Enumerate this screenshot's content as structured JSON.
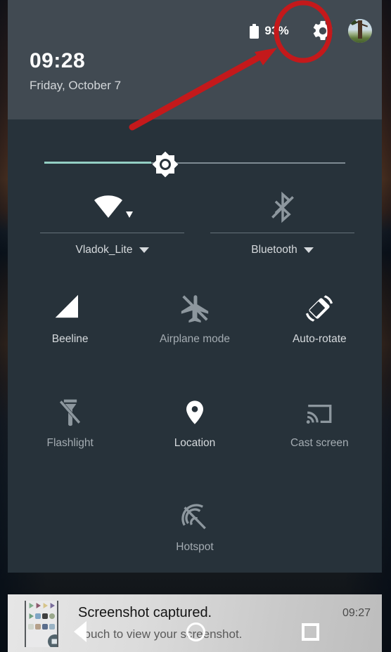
{
  "header": {
    "battery_icon": "battery-icon",
    "battery_percent": "93%",
    "settings_icon": "gear-icon",
    "avatar": "user-avatar",
    "time": "09:28",
    "date": "Friday, October 7"
  },
  "brightness": {
    "name": "brightness-slider",
    "icon": "brightness-sun-icon",
    "value_percent": 36
  },
  "dual_tiles": [
    {
      "label": "Vladok_Lite",
      "icon": "wifi-icon",
      "state": "on",
      "expandable": true
    },
    {
      "label": "Bluetooth",
      "icon": "bluetooth-disabled-icon",
      "state": "off",
      "expandable": true
    }
  ],
  "tiles": [
    {
      "label": "Beeline",
      "icon": "cell-signal-icon",
      "state": "on"
    },
    {
      "label": "Airplane mode",
      "icon": "airplane-off-icon",
      "state": "off"
    },
    {
      "label": "Auto-rotate",
      "icon": "auto-rotate-icon",
      "state": "on"
    },
    {
      "label": "Flashlight",
      "icon": "flashlight-off-icon",
      "state": "off"
    },
    {
      "label": "Location",
      "icon": "location-pin-icon",
      "state": "on"
    },
    {
      "label": "Cast screen",
      "icon": "cast-screen-icon",
      "state": "off"
    },
    {
      "label": "Hotspot",
      "icon": "hotspot-off-icon",
      "state": "off"
    }
  ],
  "notification": {
    "title": "Screenshot captured.",
    "subtitle": "Touch to view your screenshot.",
    "time": "09:27",
    "thumbnail": "screenshot-thumbnail"
  },
  "navbar": {
    "back": "back-button",
    "home": "home-button",
    "recents": "recents-button"
  },
  "annotation": {
    "highlight_color": "#c4191b",
    "circle_target": "gear-icon",
    "arrow": "pointer-arrow"
  },
  "colors": {
    "header_bg": "#414a52",
    "panel_bg": "#27323a",
    "accent": "#93cfc3",
    "label": "#d6dadd",
    "dim": "#a4acb2",
    "annotation_red": "#c4191b"
  }
}
